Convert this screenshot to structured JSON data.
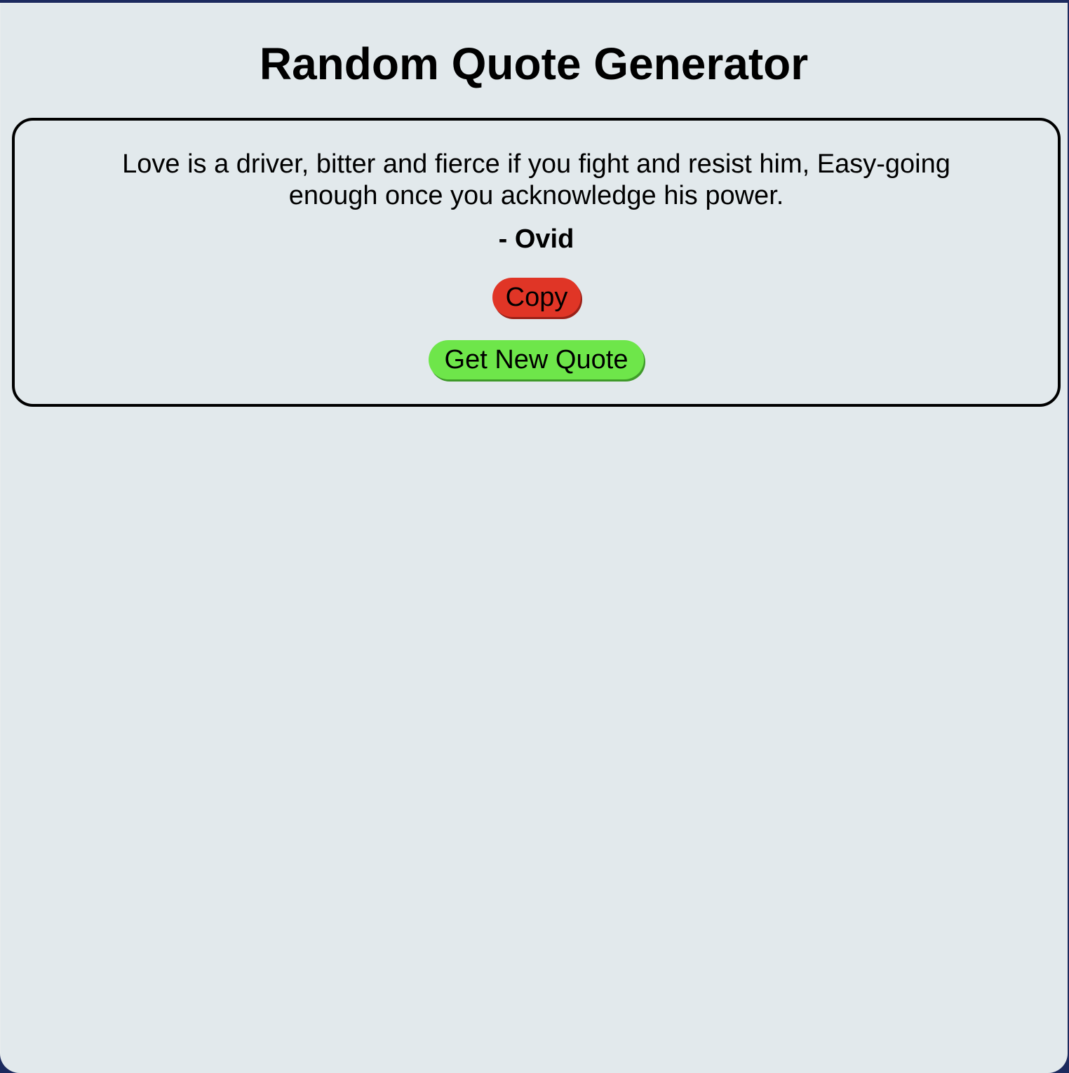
{
  "app": {
    "title": "Random Quote Generator"
  },
  "quote": {
    "text": "Love is a driver, bitter and fierce if you fight and resist him, Easy-going enough once you acknowledge his power.",
    "author": "- Ovid"
  },
  "buttons": {
    "copy_label": "Copy",
    "new_quote_label": "Get New Quote"
  },
  "colors": {
    "page_background": "#e2e9ec",
    "outer_background": "#1c2a5e",
    "copy_button": "#e03526",
    "new_quote_button": "#6ee64a"
  }
}
